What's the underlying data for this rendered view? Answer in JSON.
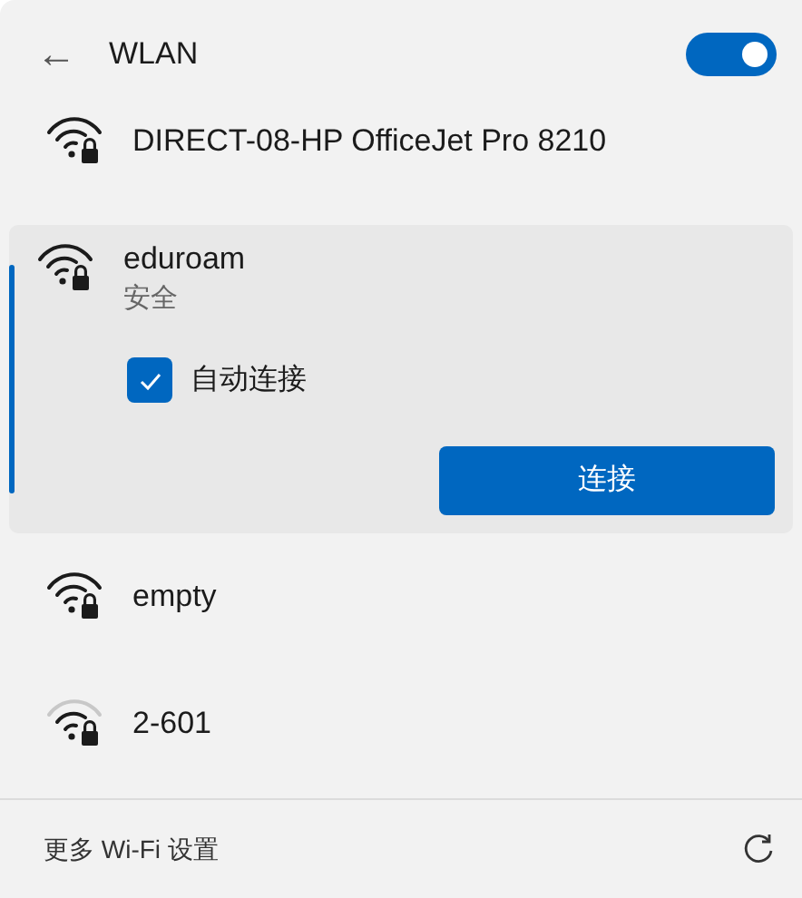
{
  "header": {
    "back": "←",
    "title": "WLAN",
    "wifi_on": true
  },
  "networks": [
    {
      "name": "DIRECT-08-HP OfficeJet Pro 8210",
      "kind": "strong",
      "secured": true,
      "expanded": false
    },
    {
      "name": "eduroam",
      "kind": "strong",
      "secured": true,
      "expanded": true,
      "selected": true,
      "status": "安全",
      "auto_connect": {
        "label": "自动连接",
        "checked": true
      },
      "button": "连接"
    },
    {
      "name": "empty",
      "kind": "strong",
      "secured": true,
      "expanded": false
    },
    {
      "name": "2-601",
      "kind": "medium",
      "secured": true,
      "expanded": false
    }
  ],
  "footer": {
    "link": "更多 Wi-Fi 设置"
  }
}
